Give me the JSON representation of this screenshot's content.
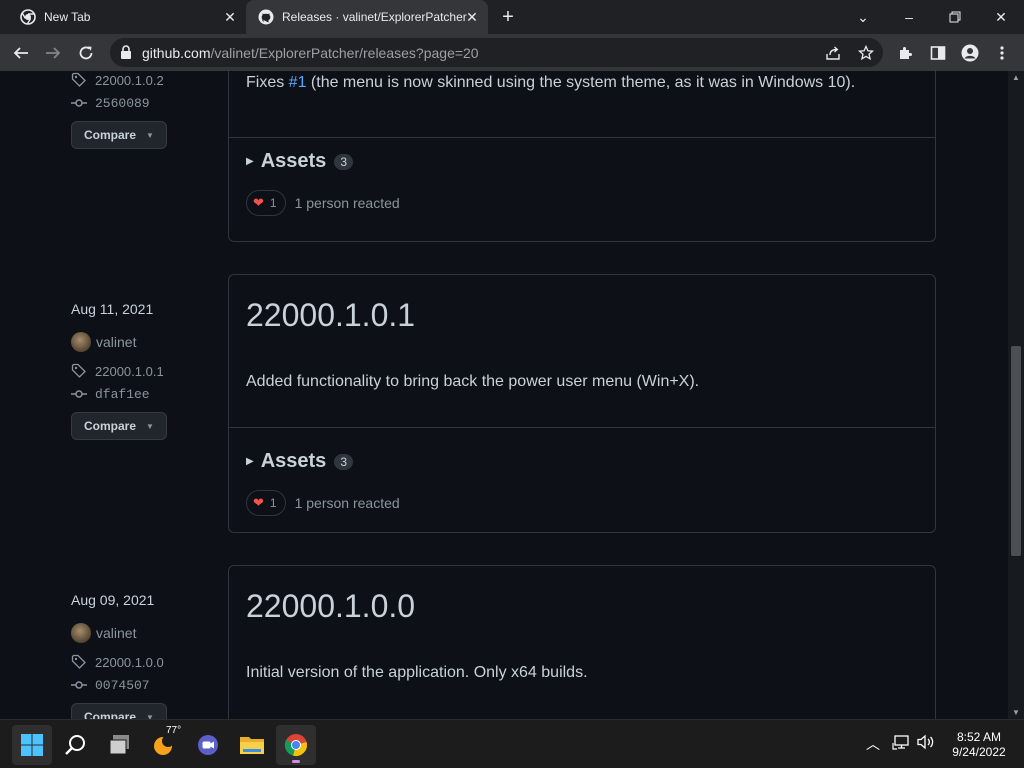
{
  "browser": {
    "tabs": [
      {
        "title": "New Tab"
      },
      {
        "title": "Releases · valinet/ExplorerPatcher"
      }
    ],
    "url_host": "github.com",
    "url_path": "/valinet/ExplorerPatcher/releases?page=20"
  },
  "releases": [
    {
      "tag": "22000.1.0.2",
      "commit": "2560089",
      "compare_label": "Compare",
      "body_prefix": "Fixes ",
      "body_link": "#1",
      "body_suffix": " (the menu is now skinned using the system theme, as it was in Windows 10).",
      "assets_label": "Assets",
      "assets_count": "3",
      "reaction_count": "1",
      "reaction_text": "1 person reacted"
    },
    {
      "date": "Aug 11, 2021",
      "author": "valinet",
      "tag": "22000.1.0.1",
      "commit": "dfaf1ee",
      "compare_label": "Compare",
      "title": "22000.1.0.1",
      "body": "Added functionality to bring back the power user menu (Win+X).",
      "assets_label": "Assets",
      "assets_count": "3",
      "reaction_count": "1",
      "reaction_text": "1 person reacted"
    },
    {
      "date": "Aug 09, 2021",
      "author": "valinet",
      "tag": "22000.1.0.0",
      "commit": "0074507",
      "compare_label": "Compare",
      "title": "22000.1.0.0",
      "body": "Initial version of the application. Only x64 builds."
    }
  ],
  "taskbar": {
    "weather_temp": "77°",
    "time": "8:52 AM",
    "date": "9/24/2022"
  },
  "colors": {
    "page_bg": "#0d1117",
    "link": "#58a6ff",
    "heart": "#f85149",
    "border": "#30363d"
  }
}
